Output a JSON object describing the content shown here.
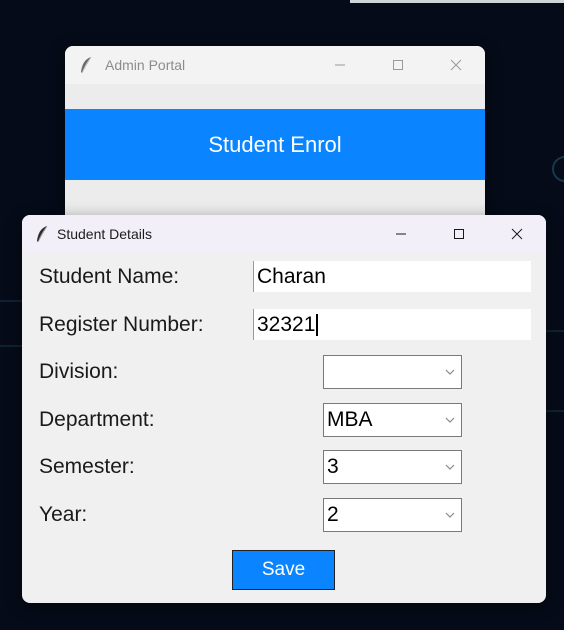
{
  "admin_window": {
    "title": "Admin Portal",
    "banner_label": "Student Enrol"
  },
  "details_window": {
    "title": "Student Details",
    "fields": {
      "student_name": {
        "label": "Student Name:",
        "value": "Charan"
      },
      "register_number": {
        "label": "Register Number:",
        "value": "32321"
      },
      "division": {
        "label": "Division:",
        "value": ""
      },
      "department": {
        "label": "Department:",
        "value": "MBA"
      },
      "semester": {
        "label": "Semester:",
        "value": "3"
      },
      "year": {
        "label": "Year:",
        "value": "2"
      }
    },
    "save_label": "Save"
  },
  "icons": {
    "app": "feather-icon",
    "minimize": "minimize-icon",
    "maximize": "maximize-icon",
    "close": "close-icon",
    "dropdown": "chevron-down-icon"
  },
  "colors": {
    "accent": "#0a84ff",
    "desktop": "#050b18"
  }
}
